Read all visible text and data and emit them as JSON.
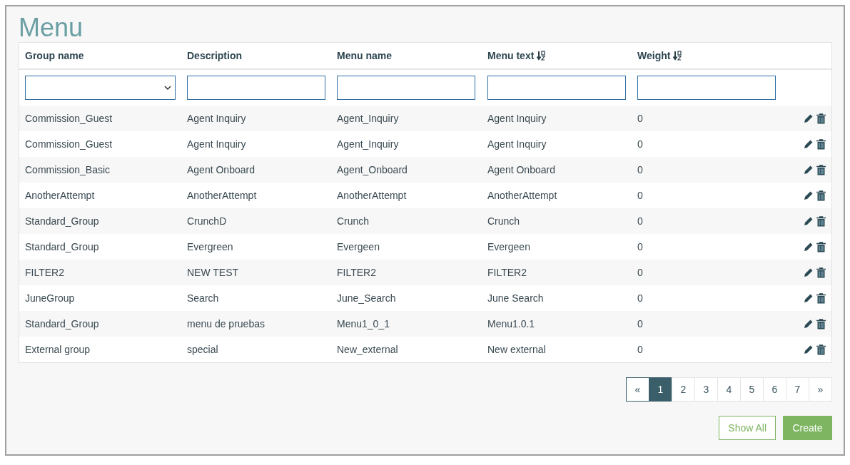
{
  "title": "Menu",
  "columns": [
    {
      "label": "Group name",
      "sortable": false,
      "kind": "select"
    },
    {
      "label": "Description",
      "sortable": false,
      "kind": "text"
    },
    {
      "label": "Menu name",
      "sortable": false,
      "kind": "text"
    },
    {
      "label": "Menu text",
      "sortable": true,
      "kind": "text"
    },
    {
      "label": "Weight",
      "sortable": true,
      "kind": "text"
    }
  ],
  "rows": [
    [
      "Commission_Guest",
      "Agent Inquiry",
      "Agent_Inquiry",
      "Agent Inquiry",
      "0"
    ],
    [
      "Commission_Guest",
      "Agent Inquiry",
      "Agent_Inquiry",
      "Agent Inquiry",
      "0"
    ],
    [
      "Commission_Basic",
      "Agent Onboard",
      "Agent_Onboard",
      "Agent Onboard",
      "0"
    ],
    [
      "AnotherAttempt",
      "AnotherAttempt",
      "AnotherAttempt",
      "AnotherAttempt",
      "0"
    ],
    [
      "Standard_Group",
      "CrunchD",
      "Crunch",
      "Crunch",
      "0"
    ],
    [
      "Standard_Group",
      "Evergreen",
      "Evergeen",
      "Evergeen",
      "0"
    ],
    [
      "FILTER2",
      "NEW TEST",
      "FILTER2",
      "FILTER2",
      "0"
    ],
    [
      "JuneGroup",
      "Search",
      "June_Search",
      "June Search",
      "0"
    ],
    [
      "Standard_Group",
      "menu de pruebas",
      "Menu1_0_1",
      "Menu1.0.1",
      "0"
    ],
    [
      "External group",
      "special",
      "New_external",
      "New external",
      "0"
    ]
  ],
  "pagination": {
    "prev": "«",
    "next": "»",
    "pages": [
      {
        "label": "1",
        "selected": true
      },
      {
        "label": "2",
        "selected": false
      },
      {
        "label": "3",
        "selected": false
      },
      {
        "label": "4",
        "selected": false
      },
      {
        "label": "5",
        "selected": false
      },
      {
        "label": "6",
        "selected": false
      },
      {
        "label": "7",
        "selected": false
      }
    ]
  },
  "buttons": [
    {
      "label": "Show All",
      "kind": "outline"
    },
    {
      "label": "Create",
      "kind": "primary"
    }
  ]
}
